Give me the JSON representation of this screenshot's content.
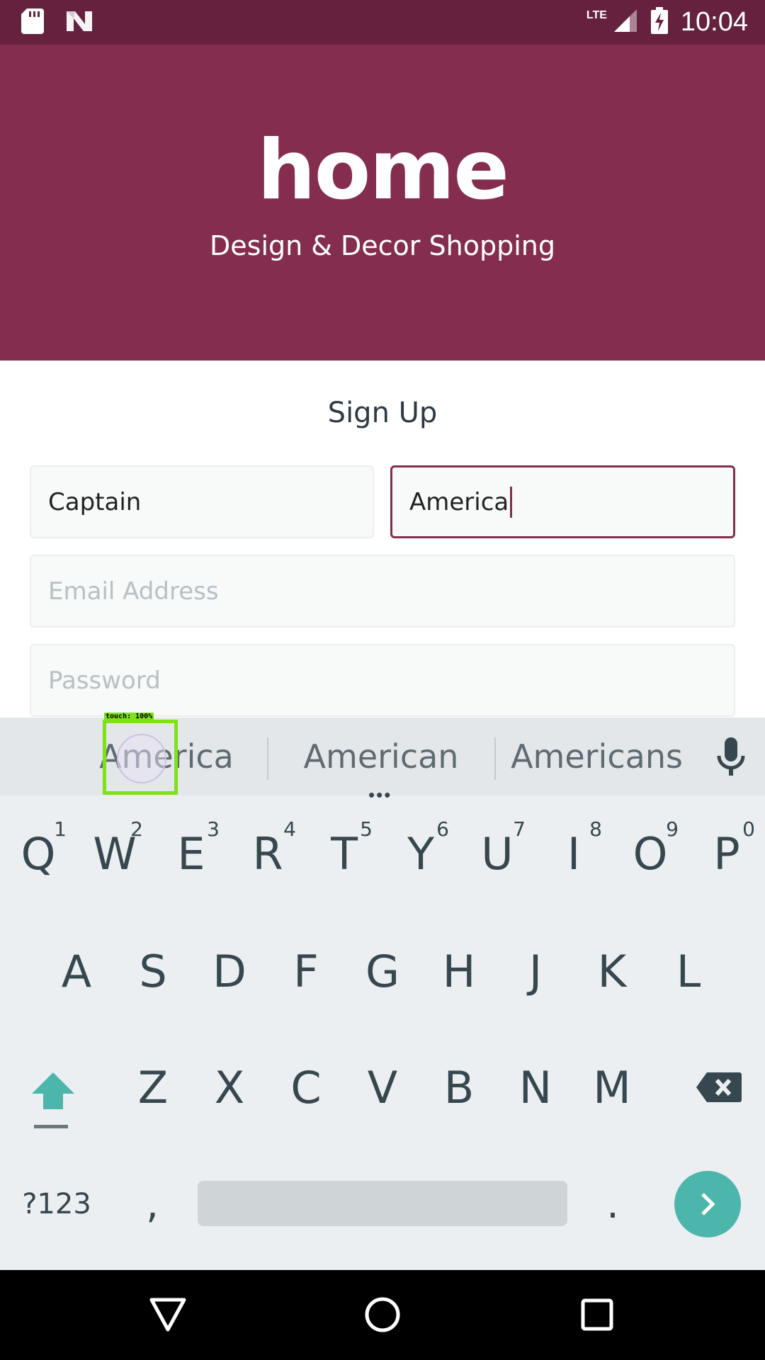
{
  "status_bar": {
    "time": "10:04",
    "network": "LTE",
    "icons": [
      "sd-card-icon",
      "notification-n-icon",
      "signal-icon",
      "battery-charging-icon"
    ]
  },
  "header": {
    "logo": "home",
    "tagline": "Design & Decor Shopping"
  },
  "form": {
    "title": "Sign Up",
    "first_name_value": "Captain",
    "last_name_value": "America",
    "email_placeholder": "Email Address",
    "password_placeholder": "Password"
  },
  "keyboard": {
    "suggestions": [
      "America",
      "American",
      "Americans"
    ],
    "touch_label": "touch: 100%",
    "row1": [
      {
        "key": "Q",
        "hint": "1"
      },
      {
        "key": "W",
        "hint": "2"
      },
      {
        "key": "E",
        "hint": "3"
      },
      {
        "key": "R",
        "hint": "4"
      },
      {
        "key": "T",
        "hint": "5"
      },
      {
        "key": "Y",
        "hint": "6"
      },
      {
        "key": "U",
        "hint": "7"
      },
      {
        "key": "I",
        "hint": "8"
      },
      {
        "key": "O",
        "hint": "9"
      },
      {
        "key": "P",
        "hint": "0"
      }
    ],
    "row2": [
      "A",
      "S",
      "D",
      "F",
      "G",
      "H",
      "J",
      "K",
      "L"
    ],
    "row3": [
      "Z",
      "X",
      "C",
      "V",
      "B",
      "N",
      "M"
    ],
    "symbols_label": "?123",
    "comma_label": ",",
    "period_label": "."
  },
  "colors": {
    "brand": "#852d4f",
    "status_bar": "#66213e",
    "accent_enter": "#4db6ac"
  }
}
